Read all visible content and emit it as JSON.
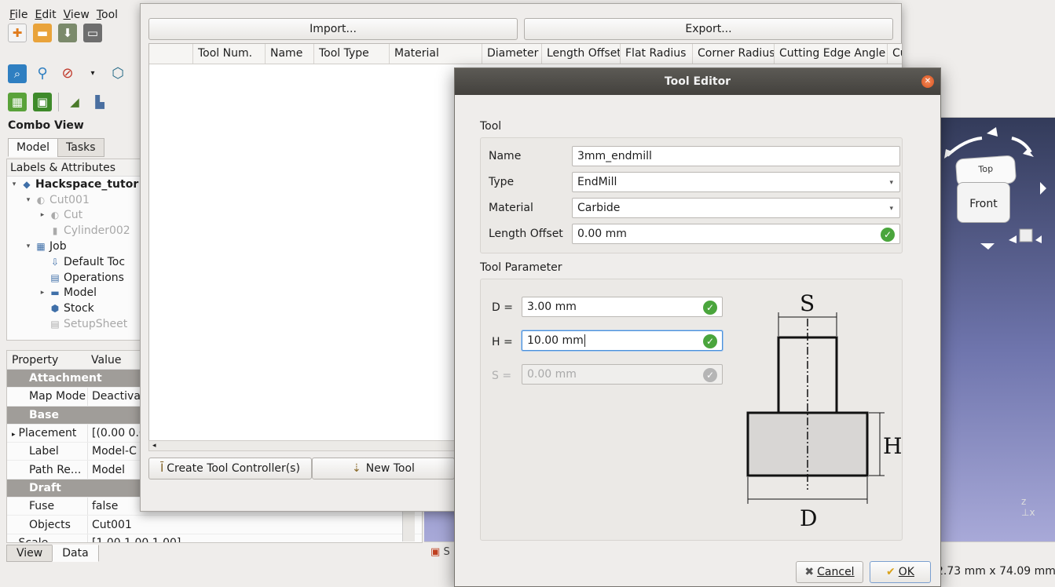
{
  "menu": [
    "File",
    "Edit",
    "View",
    "Tool"
  ],
  "toolbar_icons": [
    "new-file-icon",
    "open-icon",
    "save-icon",
    "print-icon",
    "zoom-fit-icon",
    "zoom-icon",
    "draw-style-icon",
    "view-cube-icon",
    "job-icon",
    "export-job-icon",
    "profile-icon",
    "pocket-icon"
  ],
  "combo": {
    "title": "Combo View",
    "tabs": [
      "Model",
      "Tasks"
    ],
    "tree_header": "Labels & Attributes",
    "tree": [
      {
        "label": "Hackspace_tutor",
        "caret": "▾",
        "icon": "◆",
        "bold": true,
        "dim": false,
        "indent": 0
      },
      {
        "label": "Cut001",
        "caret": "▾",
        "icon": "◐",
        "bold": false,
        "dim": true,
        "indent": 1
      },
      {
        "label": "Cut",
        "caret": "▸",
        "icon": "◐",
        "bold": false,
        "dim": true,
        "indent": 2
      },
      {
        "label": "Cylinder002",
        "caret": "",
        "icon": "▮",
        "bold": false,
        "dim": true,
        "indent": 2
      },
      {
        "label": "Job",
        "caret": "▾",
        "icon": "▦",
        "bold": false,
        "dim": false,
        "indent": 1
      },
      {
        "label": "Default Toc",
        "caret": "",
        "icon": "⇩",
        "bold": false,
        "dim": false,
        "indent": 2
      },
      {
        "label": "Operations",
        "caret": "",
        "icon": "▤",
        "bold": false,
        "dim": false,
        "indent": 2
      },
      {
        "label": "Model",
        "caret": "▸",
        "icon": "▬",
        "bold": false,
        "dim": false,
        "indent": 2
      },
      {
        "label": "Stock",
        "caret": "",
        "icon": "⬢",
        "bold": false,
        "dim": false,
        "indent": 2
      },
      {
        "label": "SetupSheet",
        "caret": "",
        "icon": "▤",
        "bold": false,
        "dim": true,
        "indent": 2
      }
    ]
  },
  "properties": {
    "headers": [
      "Property",
      "Value"
    ],
    "rows": [
      {
        "group": "Attachment"
      },
      {
        "name": "Map Mode",
        "value": "Deactiva"
      },
      {
        "group": "Base"
      },
      {
        "name": "Placement",
        "value": "[(0.00 0.0",
        "caret": "▸"
      },
      {
        "name": "Label",
        "value": "Model-C"
      },
      {
        "name": "Path Re...",
        "value": "Model"
      },
      {
        "group": "Draft"
      },
      {
        "name": "Fuse",
        "value": "false"
      },
      {
        "name": "Objects",
        "value": "Cut001"
      },
      {
        "name": "Scale",
        "value": "[1.00 1.00 1.00]",
        "caret": "▸"
      }
    ],
    "bottom_tabs": [
      "View",
      "Data"
    ]
  },
  "viewport": {
    "cube_top": "Top",
    "cube_front": "Front",
    "tab_label": "S",
    "status_dimensions": "2.73 mm x 74.09 mm"
  },
  "tool_library": {
    "import_label": "Import...",
    "export_label": "Export...",
    "columns": [
      "",
      "Tool Num.",
      "Name",
      "Tool Type",
      "Material",
      "Diameter",
      "Length Offset",
      "Flat Radius",
      "Corner Radius",
      "Cutting Edge Angle",
      "Cu"
    ],
    "create_tc_label": "Create Tool Controller(s)",
    "new_tool_label": "New Tool"
  },
  "tool_editor": {
    "title": "Tool Editor",
    "tool_group": "Tool",
    "name_label": "Name",
    "name_value": "3mm_endmill",
    "type_label": "Type",
    "type_value": "EndMill",
    "material_label": "Material",
    "material_value": "Carbide",
    "length_offset_label": "Length Offset",
    "length_offset_value": "0.00 mm",
    "param_group": "Tool Parameter",
    "d_label": "D =",
    "d_value": "3.00 mm",
    "h_label": "H =",
    "h_value": "10.00 mm",
    "s_label": "S =",
    "s_value": "0.00 mm",
    "diagram_s": "S",
    "diagram_h": "H",
    "diagram_d": "D",
    "cancel_label": "Cancel",
    "ok_label": "OK"
  },
  "colors": {
    "ok_green": "#4aa53c",
    "titlebar": "#4f4d49",
    "viewport_top": "#333b5a",
    "viewport_bottom": "#a8a9d8"
  }
}
